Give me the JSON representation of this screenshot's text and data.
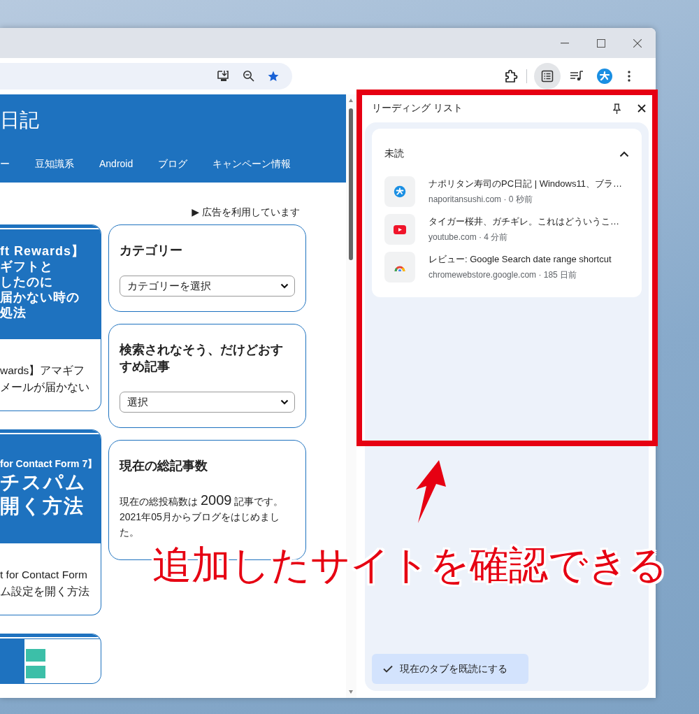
{
  "toolbar": {
    "reading_list_selected": true
  },
  "webpage": {
    "site_title": "日記",
    "nav": [
      "ー",
      "豆知識系",
      "Android",
      "ブログ",
      "キャンペーン情報"
    ],
    "ad_notice": "▶ 広告を利用しています",
    "articles": [
      {
        "kind": "text-thumbnail",
        "thumbnail_lines": [
          {
            "kind": "headline",
            "text": "ft Rewards】"
          },
          {
            "kind": "headline",
            "text": "ギフトと"
          },
          {
            "kind": "headline",
            "text": "したのに"
          },
          {
            "kind": "headline",
            "text": "届かない時の"
          },
          {
            "kind": "headline",
            "text": "処法"
          }
        ],
        "title_lines": [
          "wards】アマギフ",
          "メールが届かない"
        ]
      },
      {
        "kind": "text-thumbnail",
        "thumbnail_lines": [
          {
            "kind": "caption",
            "text": "for Contact Form 7】"
          },
          {
            "kind": "large",
            "text": "チスパム"
          },
          {
            "kind": "large",
            "text": "開く方法"
          }
        ],
        "title_lines": [
          "t for Contact Form",
          "ム設定を開く方法"
        ]
      },
      {
        "kind": "screenshot-thumbnail"
      }
    ],
    "widgets": [
      {
        "kind": "select",
        "title": "カテゴリー",
        "value": "カテゴリーを選択"
      },
      {
        "kind": "select",
        "title": "検索されなそう、だけどおすすめ記事",
        "value": "選択"
      },
      {
        "kind": "text",
        "title": "現在の総記事数",
        "text_before": "現在の総投稿数は ",
        "count": "2009",
        "text_after": " 記事です。2021年05月からブログをはじめました。"
      }
    ]
  },
  "side_panel": {
    "title": "リーディング リスト",
    "section": {
      "title": "未読",
      "expanded": true,
      "items": [
        {
          "kind": "blog",
          "title": "ナポリタン寿司のPC日記 | Windows11、ブラ…",
          "meta": "naporitansushi.com · 0 秒前"
        },
        {
          "kind": "video",
          "title": "タイガー桜井、ガチギレ。これはどういうこ…",
          "meta": "youtube.com · 4 分前"
        },
        {
          "kind": "store",
          "title": "レビュー: Google Search date range shortcut",
          "meta": "chromewebstore.google.com · 185 日前"
        }
      ]
    },
    "button": "現在のタブを既読にする"
  },
  "annotation": {
    "text": "追加したサイトを確認できる"
  }
}
